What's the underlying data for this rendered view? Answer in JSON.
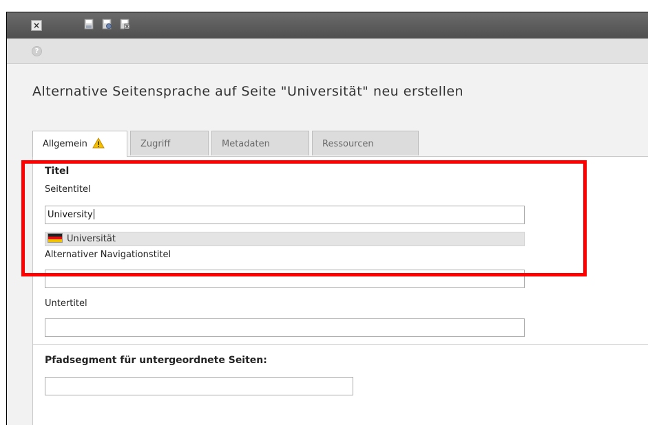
{
  "toolbar": {
    "close_icon": "close-icon",
    "save_icons": [
      "save-icon",
      "save-and-view-icon",
      "save-and-close-icon"
    ]
  },
  "subbar": {
    "help_icon": "help-icon"
  },
  "page": {
    "title": "Alternative Seitensprache auf Seite \"Universität\" neu erstellen"
  },
  "tabs": [
    {
      "label": "Allgemein",
      "active": true,
      "icon": "warning-icon"
    },
    {
      "label": "Zugriff",
      "active": false
    },
    {
      "label": "Metadaten",
      "active": false
    },
    {
      "label": "Ressourcen",
      "active": false
    }
  ],
  "form": {
    "titel_heading": "Titel",
    "seitentitel_label": "Seitentitel",
    "seitentitel_value": "University",
    "default_language_value": "Universität",
    "default_language_flag": "german-flag-icon",
    "nav_title_label": "Alternativer Navigationstitel",
    "nav_title_value": "",
    "untertitel_label": "Untertitel",
    "untertitel_value": "",
    "pfadsegment_heading": "Pfadsegment für untergeordnete Seiten:",
    "pfadsegment_value": ""
  },
  "colors": {
    "highlight": "#ff0000",
    "toolbar": "#5a5a5a",
    "warning": "#f0b400"
  }
}
